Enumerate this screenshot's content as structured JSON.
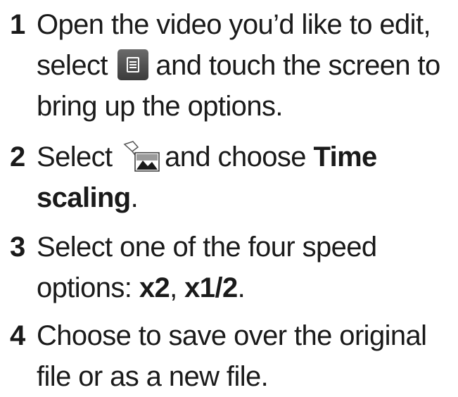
{
  "steps": [
    {
      "number": "1",
      "text_before_icon": "Open the video you’d like to edit, select",
      "icon": "menu-icon",
      "text_after_icon": "and touch the screen to bring up the options."
    },
    {
      "number": "2",
      "text_before_icon": "Select",
      "icon": "image-edit-icon",
      "text_after_icon": "and choose",
      "bold_text": "Time scaling",
      "trailing": "."
    },
    {
      "number": "3",
      "text": "Select one of the four speed options:",
      "option_a": "x2",
      "separator": ",",
      "option_b": "x1/2",
      "trailing": "."
    },
    {
      "number": "4",
      "text": "Choose to save over the original file or as a new file."
    }
  ]
}
